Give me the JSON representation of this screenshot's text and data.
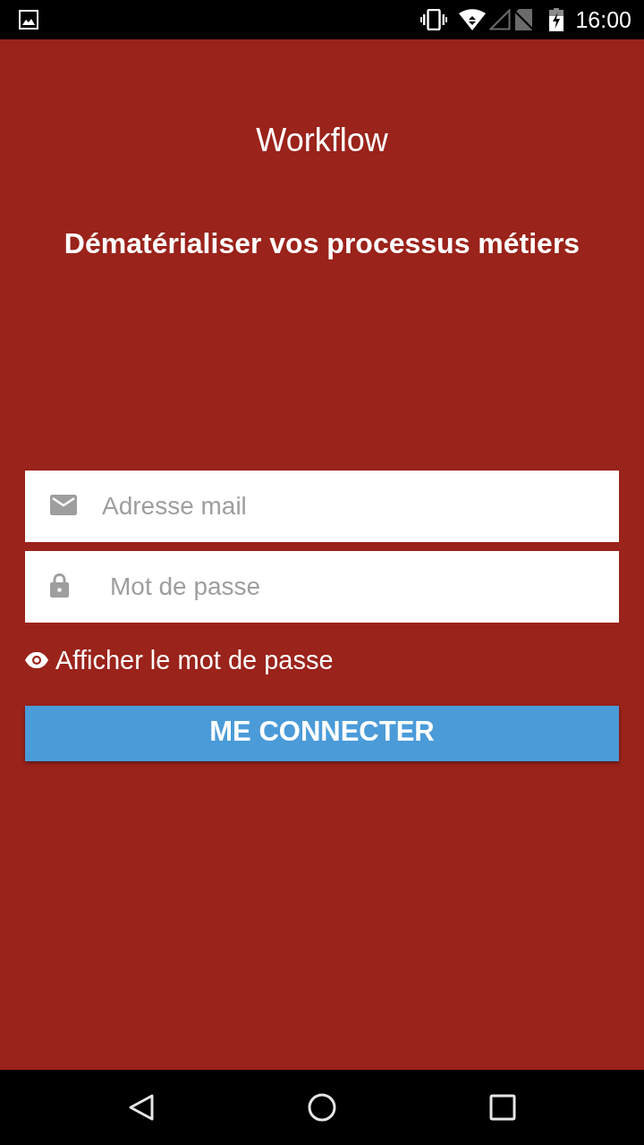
{
  "status_bar": {
    "time": "16:00"
  },
  "header": {
    "title": "Workflow",
    "subtitle": "Dématérialiser vos processus métiers"
  },
  "fields": [
    {
      "kind": "email",
      "placeholder": "Adresse mail"
    },
    {
      "kind": "password",
      "placeholder": "Mot de passe"
    }
  ],
  "show_password": {
    "label": "Afficher le mot de passe"
  },
  "login_button": {
    "label": "ME CONNECTER"
  }
}
